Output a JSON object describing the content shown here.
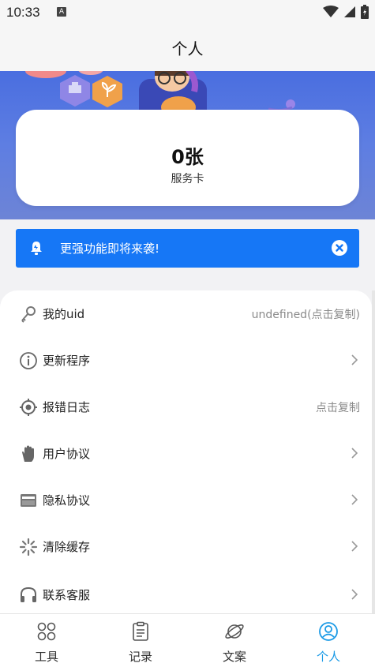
{
  "status_bar": {
    "time": "10:33",
    "badge": "A"
  },
  "header": {
    "title": "个人"
  },
  "card": {
    "count": "0张",
    "label": "服务卡"
  },
  "notice": {
    "text": "更强功能即将来袭!"
  },
  "menu": {
    "items": [
      {
        "label": "我的uid",
        "value": "undefined(点击复制)",
        "icon": "key-icon"
      },
      {
        "label": "更新程序",
        "value": "",
        "icon": "info-icon"
      },
      {
        "label": "报错日志",
        "value": "点击复制",
        "icon": "target-icon"
      },
      {
        "label": "用户协议",
        "value": "",
        "icon": "hand-icon"
      },
      {
        "label": "隐私协议",
        "value": "",
        "icon": "envelope-icon"
      },
      {
        "label": "清除缓存",
        "value": "",
        "icon": "loading-icon"
      },
      {
        "label": "联系客服",
        "value": "",
        "icon": "headset-icon"
      }
    ]
  },
  "tabbar": {
    "tabs": [
      {
        "label": "工具",
        "icon": "grid-icon"
      },
      {
        "label": "记录",
        "icon": "clipboard-icon"
      },
      {
        "label": "文案",
        "icon": "planet-icon"
      },
      {
        "label": "个人",
        "icon": "user-icon"
      }
    ],
    "active_color": "#1a9ae6"
  },
  "colors": {
    "notice_bg": "#1677f6",
    "hero_bg": "#5a78e0"
  }
}
